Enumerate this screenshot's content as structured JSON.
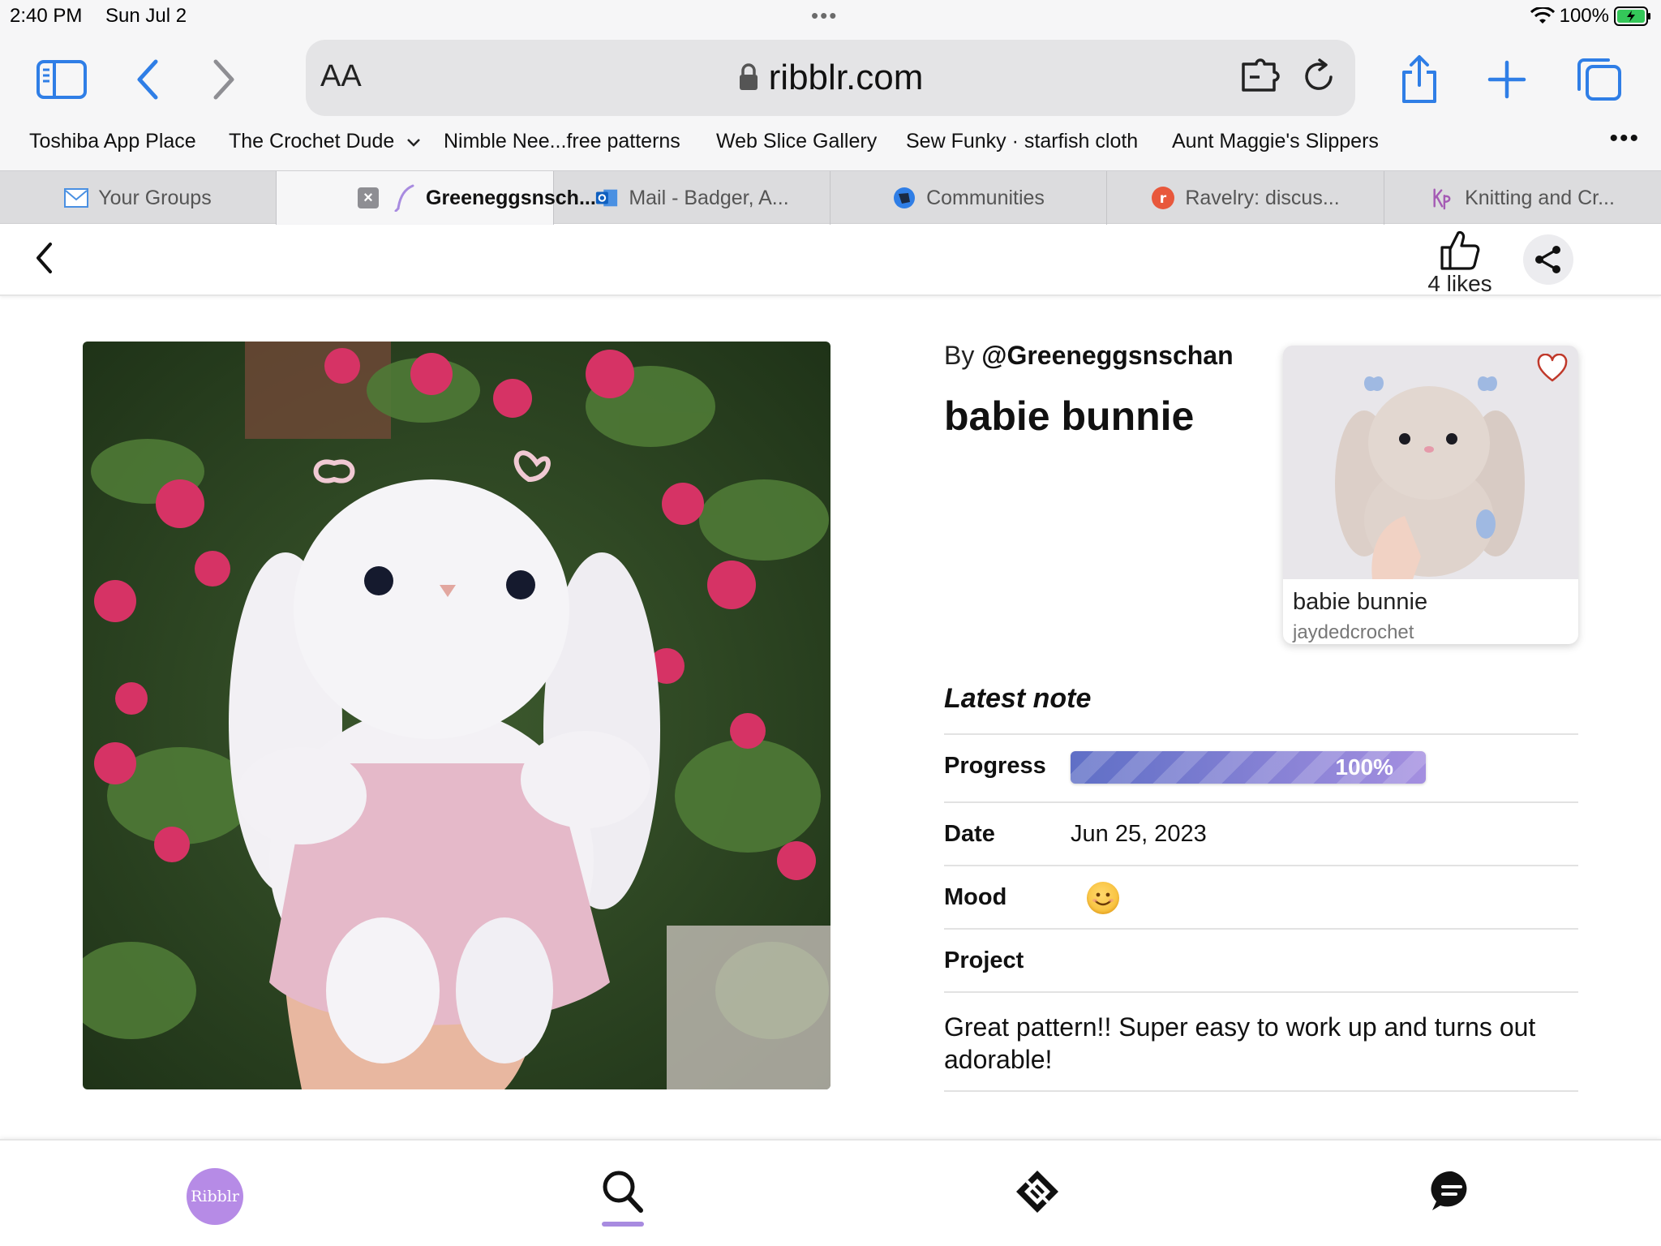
{
  "status": {
    "time": "2:40 PM",
    "date": "Sun Jul 2",
    "battery": "100%"
  },
  "browser": {
    "aa_label": "AA",
    "url": "ribblr.com",
    "bookmarks": [
      "Toshiba App Place",
      "The Crochet Dude",
      "Nimble Nee...free patterns",
      "Web Slice Gallery",
      "Sew Funky · starfish cloth",
      "Aunt Maggie's Slippers"
    ],
    "tabs": [
      {
        "label": "Your Groups",
        "icon": "mail-icon",
        "active": false
      },
      {
        "label": "Greeneggsnsch...",
        "icon": "ribblr-feather-icon",
        "active": true
      },
      {
        "label": "Mail - Badger, A...",
        "icon": "outlook-icon",
        "active": false
      },
      {
        "label": "Communities",
        "icon": "communities-icon",
        "active": false
      },
      {
        "label": "Ravelry: discus...",
        "icon": "ravelry-icon",
        "active": false
      },
      {
        "label": "Knitting and Cr...",
        "icon": "kp-icon",
        "active": false
      }
    ]
  },
  "appbar": {
    "likes_label": "4 likes"
  },
  "post": {
    "by_prefix": "By",
    "author": "@Greeneggsnschan",
    "title": "babie bunnie",
    "pattern_card": {
      "name": "babie bunnie",
      "designer": "jaydedcrochet"
    },
    "latest_note_heading": "Latest note",
    "progress_label": "Progress",
    "progress_value": 1.0,
    "progress_text": "100%",
    "date_label": "Date",
    "date_value": "Jun 25, 2023",
    "mood_label": "Mood",
    "mood_icon": "smile-emoji-icon",
    "project_label": "Project",
    "note": "Great pattern!! Super easy to work up and turns out adorable!"
  },
  "bottom_nav": {
    "logo_text": "Ribblr"
  },
  "colors": {
    "accent": "#a88be0",
    "progress_start": "#5f6fc6",
    "progress_end": "#a48fe0",
    "link_blue": "#2f7ee6"
  }
}
